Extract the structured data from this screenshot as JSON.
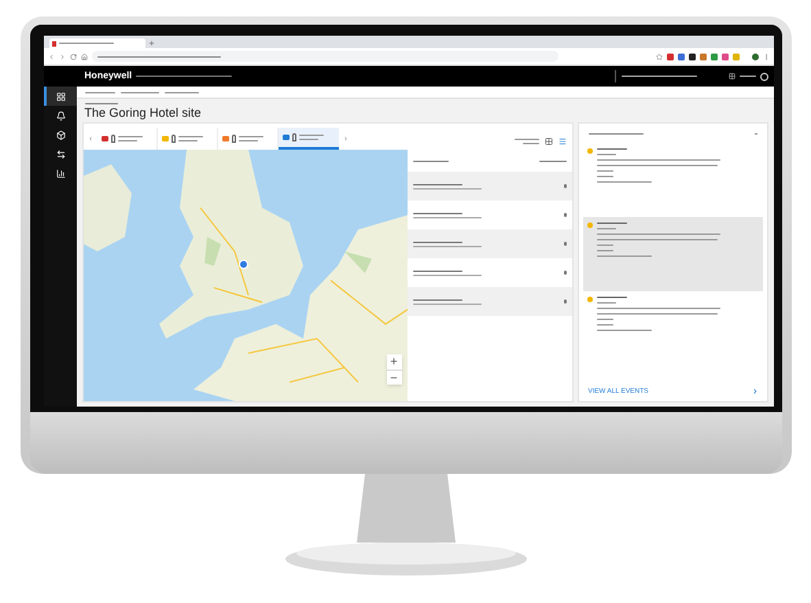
{
  "app_header": {
    "brand": "Honeywell"
  },
  "sidebar": {
    "items": [
      {
        "selected": true
      },
      {
        "selected": false
      },
      {
        "selected": false
      },
      {
        "selected": false
      },
      {
        "selected": false
      }
    ]
  },
  "page": {
    "title": "The Goring Hotel site"
  },
  "filters": [
    {
      "color": "#d32f2f",
      "selected": false
    },
    {
      "color": "#f2b705",
      "selected": false
    },
    {
      "color": "#f07a2a",
      "selected": false
    },
    {
      "color": "#1e7bd6",
      "selected": true
    }
  ],
  "map": {
    "zoom_in": "+",
    "zoom_out": "−"
  },
  "events": [
    {
      "color": "#f2b705",
      "selected": false
    },
    {
      "color": "#f2b705",
      "selected": true
    },
    {
      "color": "#f2b705",
      "selected": false
    }
  ],
  "events_footer": {
    "link": "VIEW ALL EVENTS",
    "chevron": "›"
  }
}
